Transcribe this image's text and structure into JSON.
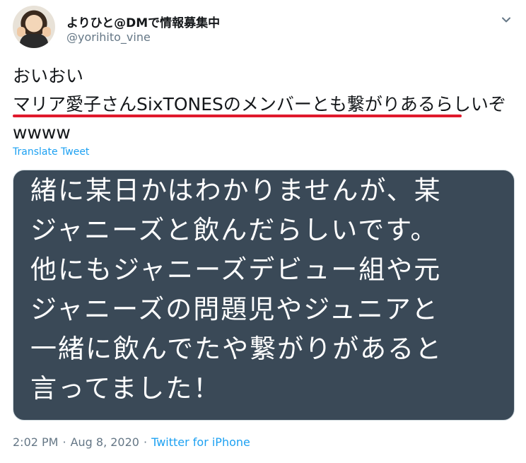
{
  "author": {
    "display_name": "よりひと@DMで情報募集中",
    "handle": "@yorihito_vine"
  },
  "tweet": {
    "lines": [
      "おいおい",
      "マリア愛子さんSixTONESのメンバーとも繋がりあるらしいぞ",
      "wwww"
    ],
    "translate_label": "Translate Tweet"
  },
  "media": {
    "lines": [
      "緒に某日かはわかりませんが、某",
      "ジャニーズと飲んだらしいです。",
      "他にもジャニーズデビュー組や元",
      "ジャニーズの問題児やジュニアと",
      "一緒に飲んでたや繋がりがあると",
      "言ってました！"
    ]
  },
  "meta": {
    "time": "2:02 PM",
    "separator": "·",
    "date": "Aug 8, 2020",
    "source": "Twitter for iPhone"
  },
  "colors": {
    "accent": "#1da1f2",
    "underline": "#e0192c",
    "media_bg": "#3a4957"
  },
  "icons": {
    "caret": "chevron-down-icon"
  }
}
